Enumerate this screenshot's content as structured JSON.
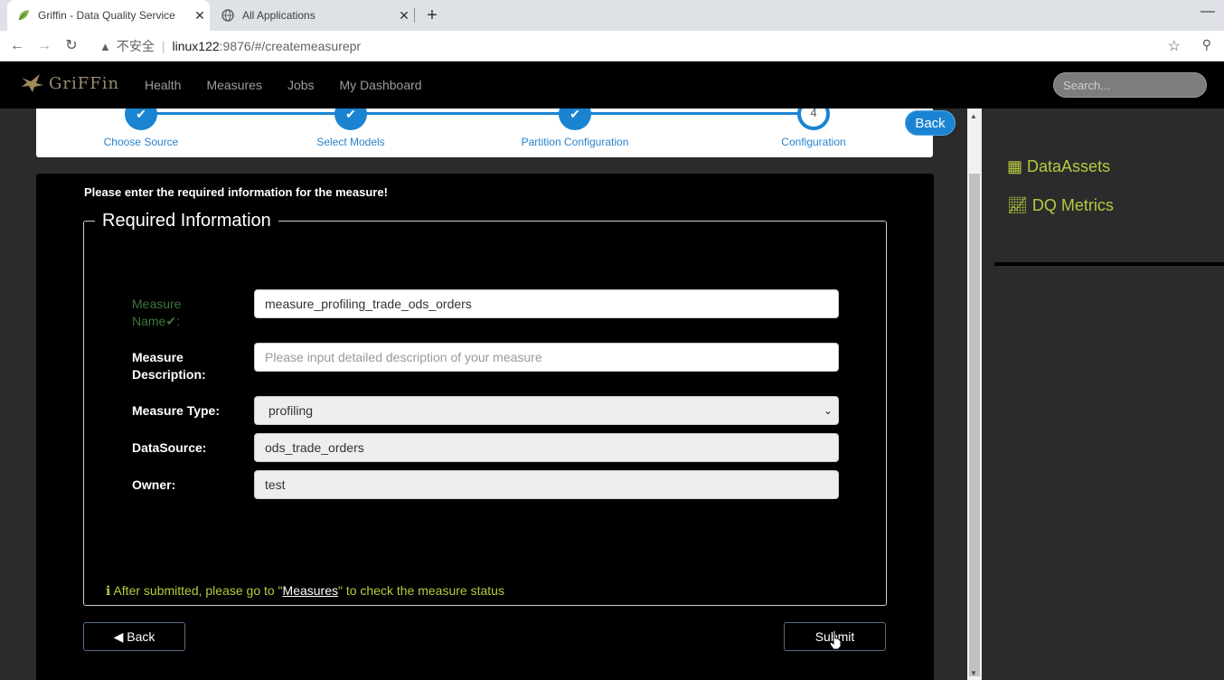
{
  "browser": {
    "tabs": [
      {
        "title": "Griffin - Data Quality Service",
        "active": true
      },
      {
        "title": "All Applications",
        "active": false
      }
    ],
    "security_label": "不安全",
    "url_host": "linux122",
    "url_path": ":9876/#/createmeasurepr"
  },
  "app": {
    "logo_text": "GriFFin",
    "nav": [
      "Health",
      "Measures",
      "Jobs",
      "My Dashboard"
    ],
    "search_placeholder": "Search..."
  },
  "wizard": {
    "steps": [
      {
        "label": "Choose Source",
        "done": true
      },
      {
        "label": "Select Models",
        "done": true
      },
      {
        "label": "Partition Configuration",
        "done": true
      },
      {
        "label": "Configuration",
        "number": "4",
        "done": false
      }
    ],
    "back_label": "Back"
  },
  "form": {
    "intro": "Please enter the required information for the measure!",
    "legend": "Required Information",
    "measure_name_label": "Measure Name",
    "measure_name_check": "✔",
    "measure_name_colon": ":",
    "measure_name_value": "measure_profiling_trade_ods_orders",
    "description_label": "Measure Description:",
    "description_placeholder": "Please input detailed description of your measure",
    "type_label": "Measure Type:",
    "type_value": "profiling",
    "datasource_label": "DataSource:",
    "datasource_value": "ods_trade_orders",
    "owner_label": "Owner:",
    "owner_value": "test",
    "note_prefix": "After submitted, please go to \"",
    "note_link": "Measures",
    "note_suffix": "\" to check the measure status",
    "back_button": "Back",
    "submit_button": "Submit"
  },
  "sidebar": {
    "items": [
      {
        "label": "DataAssets",
        "icon": "table-icon"
      },
      {
        "label": "DQ Metrics",
        "icon": "line-chart-icon"
      }
    ]
  },
  "colors": {
    "accent_blue": "#1a84d2",
    "sidebar_green": "#b8c93f",
    "valid_green": "#3c763d"
  }
}
